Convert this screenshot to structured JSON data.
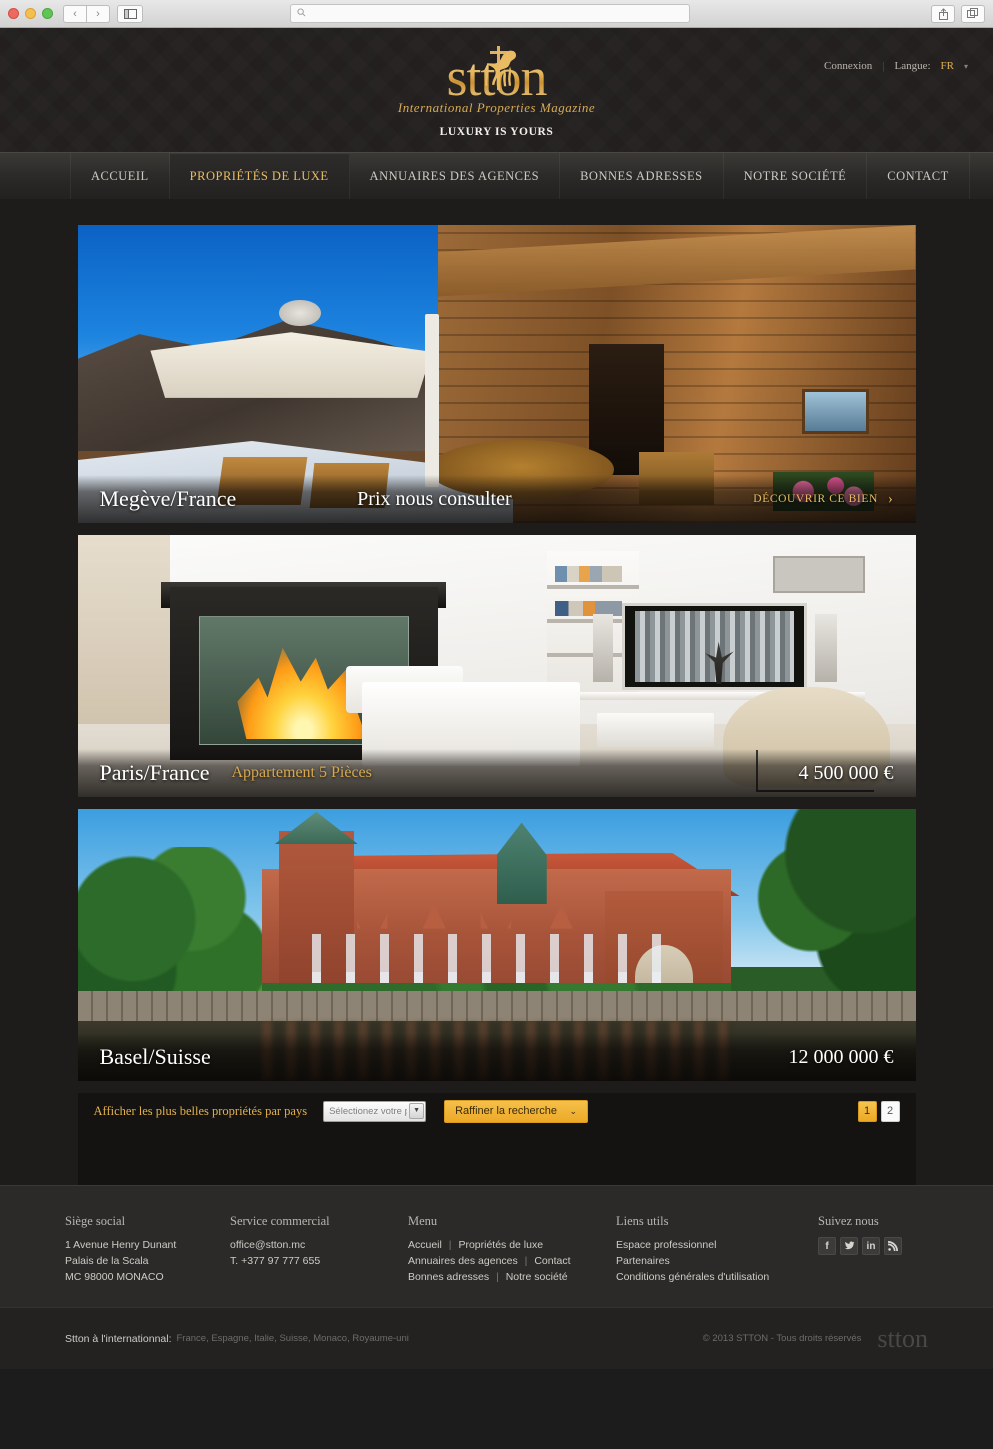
{
  "browser": {
    "url_value": "",
    "url_placeholder": "",
    "search_icon": "search-icon",
    "back_glyph": "‹",
    "forward_glyph": "›",
    "sidebar_glyph": "▤",
    "share_glyph": "⇧",
    "tabs_glyph": "⧉"
  },
  "header": {
    "login_label": "Connexion",
    "separator": "|",
    "language_label": "Langue:",
    "language_value": "FR",
    "language_caret": "▾",
    "logo_text": "stton",
    "logo_subtitle": "International Properties Magazine",
    "logo_tagline": "LUXURY IS YOURS"
  },
  "nav": {
    "items": [
      {
        "label": "ACCUEIL",
        "active": false
      },
      {
        "label": "PROPRIÉTÉS DE LUXE",
        "active": true
      },
      {
        "label": "ANNUAIRES DES AGENCES",
        "active": false
      },
      {
        "label": "BONNES ADRESSES",
        "active": false
      },
      {
        "label": "NOTRE SOCIÉTÉ",
        "active": false
      },
      {
        "label": "CONTACT",
        "active": false
      }
    ]
  },
  "properties": [
    {
      "city": "Megève/France",
      "type": "",
      "price": "Prix nous consulter",
      "cta": "DÉCOUVRIR CE BIEN",
      "cta_chevron": "›"
    },
    {
      "city": "Paris/France",
      "type": "Appartement 5 Pièces",
      "price": "4 500 000 €",
      "cta": "",
      "cta_chevron": ""
    },
    {
      "city": "Basel/Suisse",
      "type": "",
      "price": "12 000 000 €",
      "cta": "",
      "cta_chevron": ""
    }
  ],
  "filter": {
    "label": "Afficher les plus belles propriétés par pays",
    "country_placeholder": "Sélectionez votre pays",
    "country_value": "Sélectionez votre pays",
    "select_caret": "▼",
    "refine_label": "Raffiner la recherche",
    "refine_caret": "⌄",
    "pages": [
      {
        "label": "1",
        "active": true
      },
      {
        "label": "2",
        "active": false
      }
    ]
  },
  "footer": {
    "col1": {
      "heading": "Siège social",
      "line1": "1 Avenue Henry Dunant",
      "line2": "Palais de la Scala",
      "line3": "MC 98000 MONACO"
    },
    "col2": {
      "heading": "Service commercial",
      "email": "office@stton.mc",
      "phone": "T. +377 97 777 655"
    },
    "col3": {
      "heading": "Menu",
      "r1a": "Accueil",
      "r1b": "Propriétés de luxe",
      "r2a": "Annuaires des agences",
      "r2b": "Contact",
      "r3a": "Bonnes adresses",
      "r3b": "Notre société",
      "divider": "|"
    },
    "col4": {
      "heading": "Liens utils",
      "l1": "Espace professionnel",
      "l2": "Partenaires",
      "l3": "Conditions générales d'utilisation"
    },
    "col5": {
      "heading": "Suivez nous",
      "social": [
        {
          "name": "facebook-icon",
          "glyph": "f"
        },
        {
          "name": "twitter-icon",
          "glyph": "ᵛ"
        },
        {
          "name": "linkedin-icon",
          "glyph": "in"
        },
        {
          "name": "rss-icon",
          "glyph": "◠"
        }
      ]
    }
  },
  "bottom": {
    "label": "Stton à l'internationnal:",
    "countries": "France, Espagne, Italie, Suisse, Monaco, Royaume-uni",
    "copyright": "© 2013 STTON - Tous droits réservés",
    "logo": "stton"
  },
  "colors": {
    "gold": "#e8bd63",
    "gold_button": "#f0ac2c",
    "header_bg": "#221f1e",
    "page_bg": "#1e1c1b",
    "footer_bg": "#2b2a29"
  }
}
